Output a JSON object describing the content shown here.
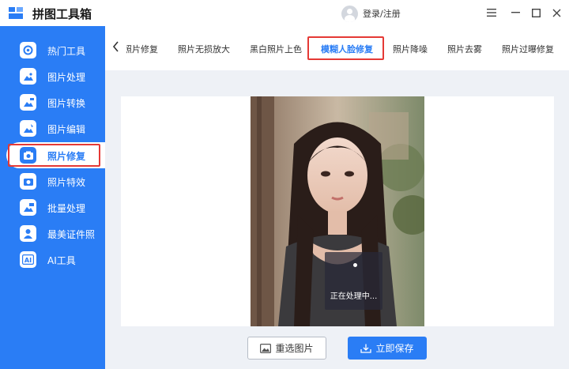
{
  "app": {
    "title": "拼图工具箱",
    "login_text": "登录/注册",
    "window_controls": [
      "menu-icon",
      "minimize-icon",
      "maximize-icon",
      "close-icon"
    ]
  },
  "sidebar": {
    "items": [
      {
        "label": "热门工具",
        "icon": "hot-tools-icon",
        "active": false
      },
      {
        "label": "图片处理",
        "icon": "image-process-icon",
        "active": false
      },
      {
        "label": "图片转换",
        "icon": "image-convert-icon",
        "active": false
      },
      {
        "label": "图片编辑",
        "icon": "image-edit-icon",
        "active": false
      },
      {
        "label": "照片修复",
        "icon": "photo-repair-icon",
        "active": true
      },
      {
        "label": "照片特效",
        "icon": "photo-effects-icon",
        "active": false
      },
      {
        "label": "批量处理",
        "icon": "batch-process-icon",
        "active": false
      },
      {
        "label": "最美证件照",
        "icon": "id-photo-icon",
        "active": false
      },
      {
        "label": "AI工具",
        "icon": "ai-tools-icon",
        "active": false
      }
    ]
  },
  "tabs": {
    "items": [
      {
        "label": "老照片修复",
        "active": false
      },
      {
        "label": "照片无损放大",
        "active": false
      },
      {
        "label": "黑白照片上色",
        "active": false
      },
      {
        "label": "模糊人脸修复",
        "active": true
      },
      {
        "label": "照片降噪",
        "active": false
      },
      {
        "label": "照片去雾",
        "active": false
      },
      {
        "label": "照片过曝修复",
        "active": false
      }
    ]
  },
  "preview": {
    "processing_text": "正在处理中..."
  },
  "actions": {
    "reselect_label": "重选图片",
    "save_label": "立即保存"
  },
  "colors": {
    "accent": "#2a7df5",
    "highlight": "#e53935",
    "background": "#eef1f6"
  }
}
